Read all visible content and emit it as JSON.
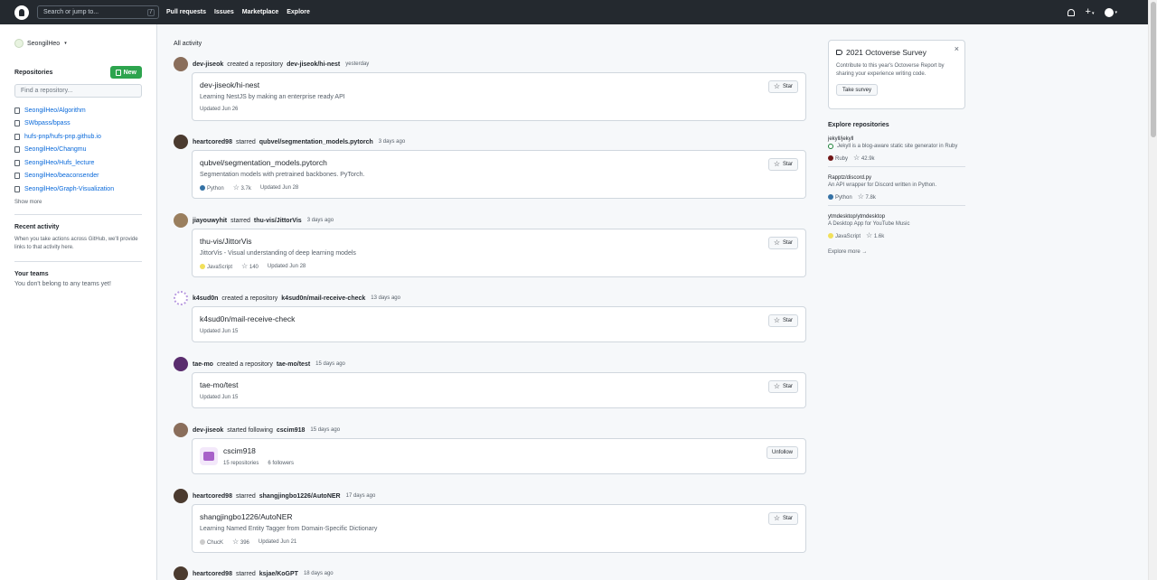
{
  "header": {
    "search_placeholder": "Search or jump to...",
    "search_key": "/",
    "nav": [
      "Pull requests",
      "Issues",
      "Marketplace",
      "Explore"
    ],
    "plus": "+",
    "caret": "▾"
  },
  "sidebar": {
    "username": "SeongilHeo",
    "repositories_title": "Repositories",
    "new_button": "New",
    "find_placeholder": "Find a repository...",
    "repos": [
      "SeongilHeo/Algorithm",
      "SWbpass/bpass",
      "hufs-pnp/hufs-pnp.github.io",
      "SeongilHeo/Changmu",
      "SeongilHeo/Hufs_lecture",
      "SeongilHeo/beaconsender",
      "SeongilHeo/Graph-Visualization"
    ],
    "show_more": "Show more",
    "recent_title": "Recent activity",
    "recent_text": "When you take actions across GitHub, we'll provide links to that activity here.",
    "teams_title": "Your teams",
    "teams_text": "You don't belong to any teams yet!"
  },
  "feed": {
    "title": "All activity",
    "events": [
      {
        "actor": "dev-jiseok",
        "action": "created a repository",
        "target": "dev-jiseok/hi-nest",
        "time": "yesterday",
        "avatar_color": "#8a6e5b",
        "card": {
          "name": "dev-jiseok/hi-nest",
          "desc": "Learning NestJS by making an enterprise ready API",
          "updated": "Updated Jun 26",
          "button": "Star"
        }
      },
      {
        "actor": "heartcored98",
        "action": "starred",
        "target": "qubvel/segmentation_models.pytorch",
        "time": "3 days ago",
        "avatar_color": "#4b3b2f",
        "card": {
          "name": "qubvel/segmentation_models.pytorch",
          "desc": "Segmentation models with pretrained backbones. PyTorch.",
          "lang": "Python",
          "lang_color": "#3572A5",
          "stars": "3.7k",
          "updated": "Updated Jun 28",
          "button": "Star"
        }
      },
      {
        "actor": "jiayouwyhit",
        "action": "starred",
        "target": "thu-vis/JittorVis",
        "time": "3 days ago",
        "avatar_color": "#9a7f5e",
        "card": {
          "name": "thu-vis/JittorVis",
          "desc": "JittorVis - Visual understanding of deep learning models",
          "lang": "JavaScript",
          "lang_color": "#f1e05a",
          "stars": "140",
          "updated": "Updated Jun 28",
          "button": "Star"
        }
      },
      {
        "actor": "k4sud0n",
        "action": "created a repository",
        "target": "k4sud0n/mail-receive-check",
        "time": "13 days ago",
        "avatar_color": "#b89be0",
        "card": {
          "name": "k4sud0n/mail-receive-check",
          "updated": "Updated Jun 15",
          "button": "Star"
        }
      },
      {
        "actor": "tae-mo",
        "action": "created a repository",
        "target": "tae-mo/test",
        "time": "15 days ago",
        "avatar_color": "#5a2d6e",
        "card": {
          "name": "tae-mo/test",
          "updated": "Updated Jun 15",
          "button": "Star"
        }
      },
      {
        "actor": "dev-jiseok",
        "action": "started following",
        "target": "cscim918",
        "time": "15 days ago",
        "avatar_color": "#8a6e5b",
        "card": {
          "name": "cscim918",
          "repos": "15 repositories",
          "followers": "6 followers",
          "button": "Unfollow"
        }
      },
      {
        "actor": "heartcored98",
        "action": "starred",
        "target": "shangjingbo1226/AutoNER",
        "time": "17 days ago",
        "avatar_color": "#4b3b2f",
        "card": {
          "name": "shangjingbo1226/AutoNER",
          "desc": "Learning Named Entity Tagger from Domain-Specific Dictionary",
          "lang": "ChucK",
          "lang_color": "#cccccc",
          "stars": "396",
          "updated": "Updated Jun 21",
          "button": "Star"
        }
      },
      {
        "actor": "heartcored98",
        "action": "starred",
        "target": "ksjae/KoGPT",
        "time": "18 days ago",
        "avatar_color": "#4b3b2f"
      }
    ]
  },
  "right": {
    "survey_title": "2021 Octoverse Survey",
    "survey_text": "Contribute to this year's Octoverse Report by sharing your experience writing code.",
    "survey_button": "Take survey",
    "close": "×",
    "explore_title": "Explore repositories",
    "explore": [
      {
        "name": "jekyll/jekyll",
        "desc": "Jekyll is a blog-aware static site generator in Ruby",
        "lang": "Ruby",
        "lang_color": "#701516",
        "stars": "42.9k"
      },
      {
        "name": "Rapptz/discord.py",
        "desc": "An API wrapper for Discord written in Python.",
        "lang": "Python",
        "lang_color": "#3572A5",
        "stars": "7.8k"
      },
      {
        "name": "ytmdesktop/ytmdesktop",
        "desc": "A Desktop App for YouTube Music",
        "lang": "JavaScript",
        "lang_color": "#f1e05a",
        "stars": "1.6k"
      }
    ],
    "explore_more": "Explore more →"
  }
}
